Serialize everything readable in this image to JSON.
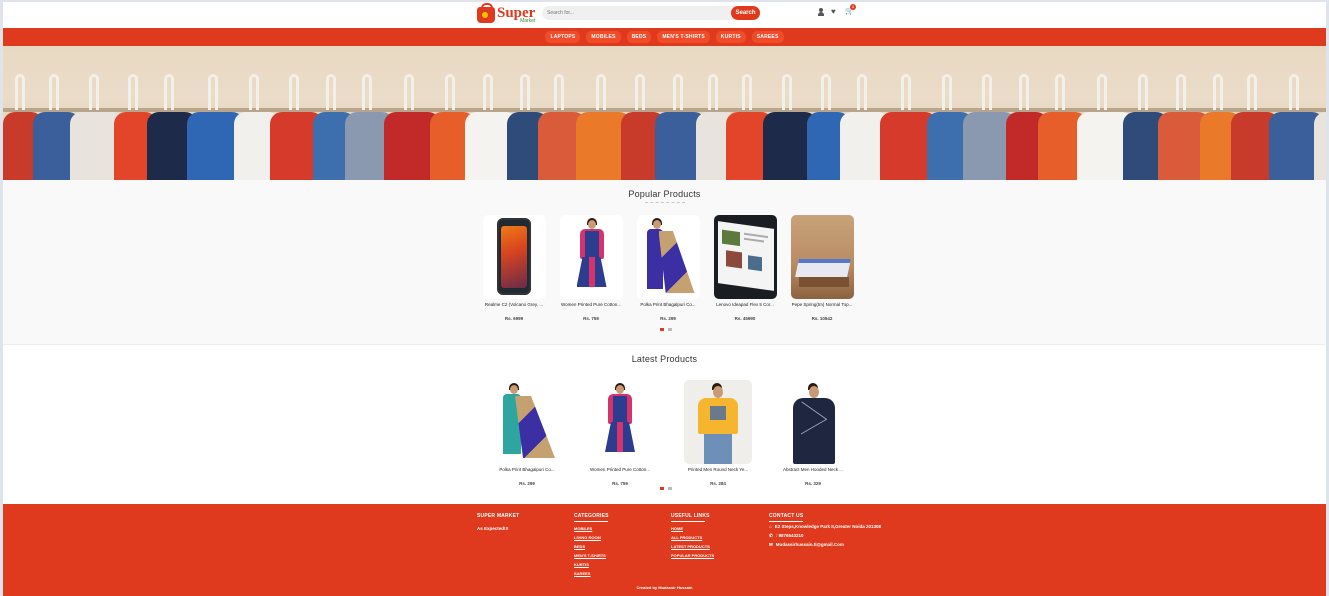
{
  "header": {
    "logo_main": "Super",
    "logo_sub": "Market",
    "search_placeholder": "Search for...",
    "search_button": "Search",
    "cart_count": "0"
  },
  "nav": [
    "LAPTOPS",
    "MOBILES",
    "BEDS",
    "MEN'S T-SHIRTS",
    "KURTIS",
    "SAREES"
  ],
  "popular": {
    "title": "Popular Products",
    "products": [
      {
        "name": "Realme C2 (Volcano Grey, ...",
        "price": "Rs. 6999"
      },
      {
        "name": "Women Printed Pure Cotton...",
        "price": "Rs. 759"
      },
      {
        "name": "Polka Print Bhagalpuri Co...",
        "price": "Rs. 299"
      },
      {
        "name": "Lenovo Ideapad Flex 5 Cor...",
        "price": "Rs. 45990"
      },
      {
        "name": "Pepe Spring(tm) Normal Top...",
        "price": "Rs. 10542"
      }
    ]
  },
  "latest": {
    "title": "Latest Products",
    "products": [
      {
        "name": "Polka Print Bhagalpuri Co...",
        "price": "Rs. 299"
      },
      {
        "name": "Women Printed Pure Cotton...",
        "price": "Rs. 759"
      },
      {
        "name": "Printed Men Round Neck Ye...",
        "price": "Rs. 284"
      },
      {
        "name": "Abstract Men Hooded Neck ...",
        "price": "Rs. 329"
      }
    ]
  },
  "footer": {
    "brand_head": "SUPER MARKET",
    "brand_tagline": "As Expected!!!",
    "categories_head": "CATEGORIES",
    "categories": [
      "MOBILES",
      "LIVING ROOM",
      "BEDS",
      "MEN'S T-SHIRTS",
      "KURTIS",
      "SAREES"
    ],
    "links_head": "USEFUL LINKS",
    "links": [
      "HOME",
      "ALL PRODUCTS",
      "LATEST PRODUCTS",
      "POPULAR PRODUCTS"
    ],
    "contact_head": "CONTACT US",
    "address": "E2 Steps,Knowledge Park II,Greater Noida 201308",
    "phone": ": 9876543210",
    "email": "Mudassirhussain.tl@gmail.Com",
    "credit": "Created by Mudassir Hussain"
  },
  "colors": {
    "accent": "#e03a1e"
  }
}
